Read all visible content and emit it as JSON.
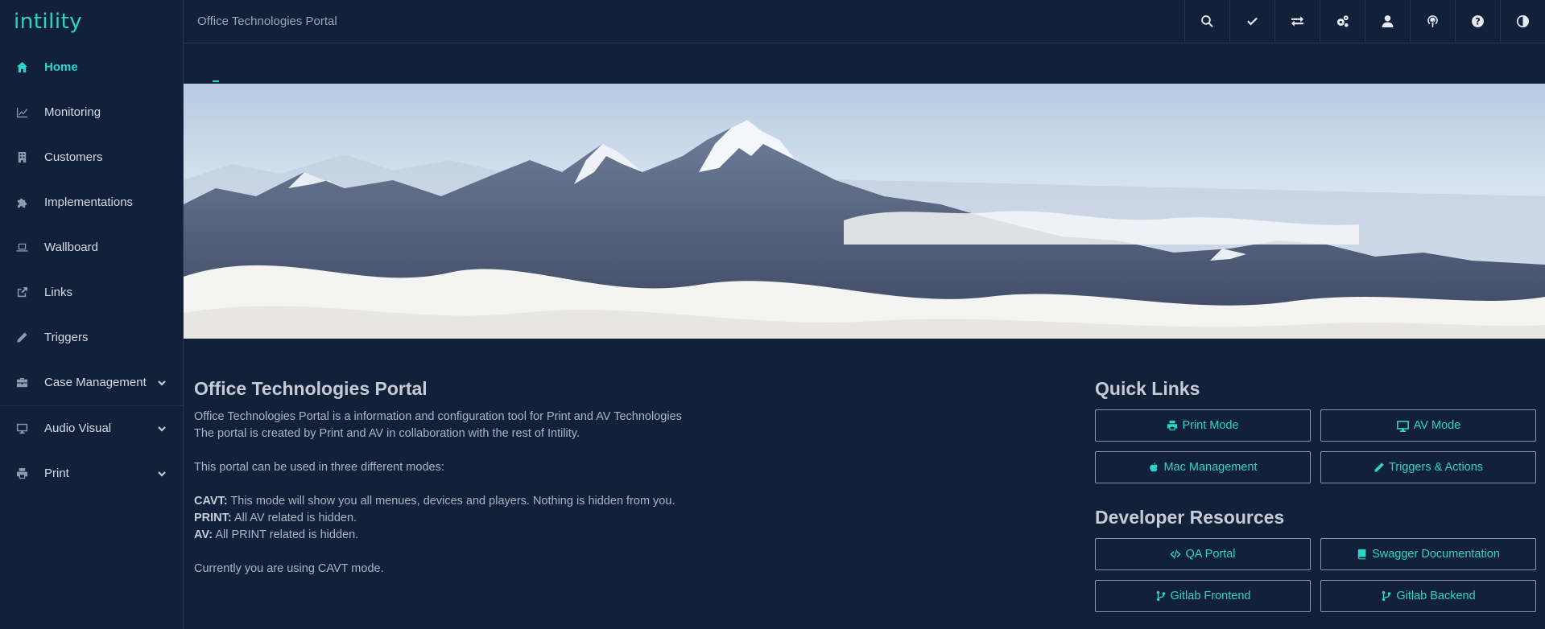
{
  "app": {
    "logo": "intility",
    "title": "Office Technologies Portal"
  },
  "sidebar": {
    "items": [
      {
        "label": "Home",
        "icon": "home-icon",
        "active": true
      },
      {
        "label": "Monitoring",
        "icon": "chart-line-icon"
      },
      {
        "label": "Customers",
        "icon": "building-icon"
      },
      {
        "label": "Implementations",
        "icon": "puzzle-icon"
      },
      {
        "label": "Wallboard",
        "icon": "laptop-icon"
      },
      {
        "label": "Links",
        "icon": "external-link-icon"
      },
      {
        "label": "Triggers",
        "icon": "pencil-icon"
      },
      {
        "label": "Case Management",
        "icon": "briefcase-icon",
        "expandable": true
      },
      {
        "label": "Audio Visual",
        "icon": "monitor-icon",
        "expandable": true
      },
      {
        "label": "Print",
        "icon": "printer-icon",
        "expandable": true
      }
    ]
  },
  "topbar_icons": [
    "search-icon",
    "check-icon",
    "exchange-icon",
    "cogs-icon",
    "user-icon",
    "podcast-icon",
    "help-icon",
    "contrast-icon"
  ],
  "intro": {
    "heading": "Office Technologies Portal",
    "line1": "Office Technologies Portal is a information and configuration tool for Print and AV Technologies",
    "line2": "The portal is created by Print and AV in collaboration with the rest of Intility.",
    "line3": "This portal can be used in three different modes:",
    "modes": [
      {
        "name": "CAVT:",
        "text": " This mode will show you all menues, devices and players. Nothing is hidden from you."
      },
      {
        "name": "PRINT:",
        "text": " All AV related is hidden."
      },
      {
        "name": "AV:",
        "text": " All PRINT related is hidden."
      }
    ],
    "current": "Currently you are using CAVT mode."
  },
  "quick_links": {
    "title": "Quick Links",
    "buttons": [
      {
        "label": "Print Mode",
        "icon": "printer-icon"
      },
      {
        "label": "AV Mode",
        "icon": "monitor-icon"
      },
      {
        "label": "Mac Management",
        "icon": "apple-icon"
      },
      {
        "label": "Triggers & Actions",
        "icon": "pencil-icon"
      }
    ]
  },
  "dev_resources": {
    "title": "Developer Resources",
    "buttons": [
      {
        "label": "QA Portal",
        "icon": "code-icon"
      },
      {
        "label": "Swagger Documentation",
        "icon": "book-icon"
      },
      {
        "label": "Gitlab Frontend",
        "icon": "branch-icon"
      },
      {
        "label": "Gitlab Backend",
        "icon": "branch-icon"
      }
    ]
  },
  "colors": {
    "background": "#13203a",
    "accent": "#2ad4c6",
    "border": "#26334b"
  }
}
